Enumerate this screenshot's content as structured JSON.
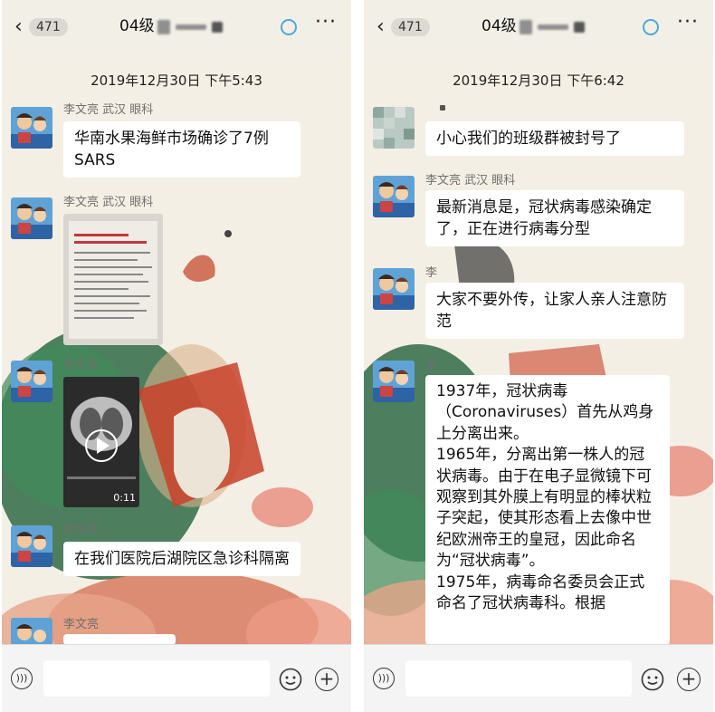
{
  "left": {
    "header": {
      "back_count": "471",
      "title": "04级"
    },
    "timestamp": "2019年12月30日 下午5:43",
    "messages": [
      {
        "sender": "李文亮 武汉 眼科",
        "text": "华南水果海鲜市场确诊了7例 SARS"
      },
      {
        "sender": "李文亮 武汉 眼科"
      },
      {
        "sender": "李文亮",
        "duration": "0:11"
      },
      {
        "sender": "李文亮",
        "text": "在我们医院后湖院区急诊科隔离"
      },
      {
        "sender": "李文亮"
      }
    ]
  },
  "right": {
    "header": {
      "back_count": "471",
      "title": "04级"
    },
    "timestamp": "2019年12月30日 下午6:42",
    "messages": [
      {
        "text": "小心我们的班级群被封号了"
      },
      {
        "sender": "李文亮 武汉 眼科",
        "text": "最新消息是，冠状病毒感染确定了，正在进行病毒分型"
      },
      {
        "sender": "李",
        "text": "大家不要外传，让家人亲人注意防范"
      },
      {
        "sender": "李",
        "text": "1937年，冠状病毒（Coronaviruses）首先从鸡身上分离出来。\n1965年，分离出第一株人的冠状病毒。由于在电子显微镜下可观察到其外膜上有明显的棒状粒子突起，使其形态看上去像中世纪欧洲帝王的皇冠，因此命名为“冠状病毒”。\n1975年，病毒命名委员会正式命名了冠状病毒科。根据"
      }
    ]
  },
  "icons": {
    "back": "chevron-left-icon",
    "sync": "ring-icon",
    "more": "more-dots-icon",
    "voice": "voice-icon",
    "emoji": "emoji-icon",
    "plus": "plus-icon"
  },
  "colors": {
    "chat_bg": "#f4efe4",
    "bubble": "#ffffff",
    "ring": "#4fa8d8"
  }
}
